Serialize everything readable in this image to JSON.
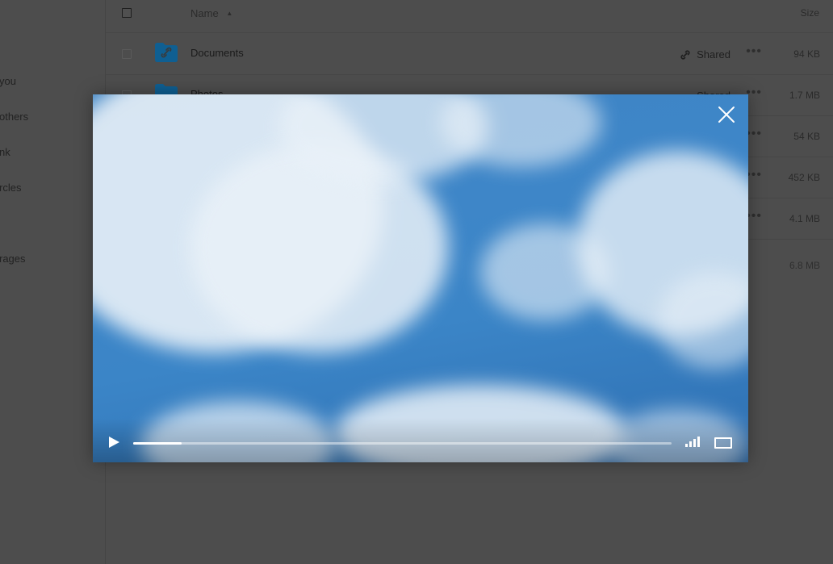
{
  "sidebar": {
    "items": [
      {
        "label": "you"
      },
      {
        "label": "others"
      },
      {
        "label": "nk"
      },
      {
        "label": "rcles"
      },
      {
        "label": "rages"
      }
    ]
  },
  "files": {
    "header": {
      "name": "Name",
      "size": "Size"
    },
    "rows": [
      {
        "name": "Documents",
        "shared": "Shared",
        "size": "94 KB"
      },
      {
        "name": "Photos",
        "shared": "Shared",
        "size": "1.7 MB"
      },
      {
        "name": "",
        "shared": "",
        "size": "54 KB"
      },
      {
        "name": "",
        "shared": "",
        "size": "452 KB"
      },
      {
        "name": "",
        "shared": "",
        "size": "4.1 MB"
      }
    ],
    "total_size": "6.8 MB"
  },
  "player": {
    "progress_fraction": 0.09
  },
  "colors": {
    "folder": "#0f74b5",
    "sky": "#3e86c8"
  }
}
